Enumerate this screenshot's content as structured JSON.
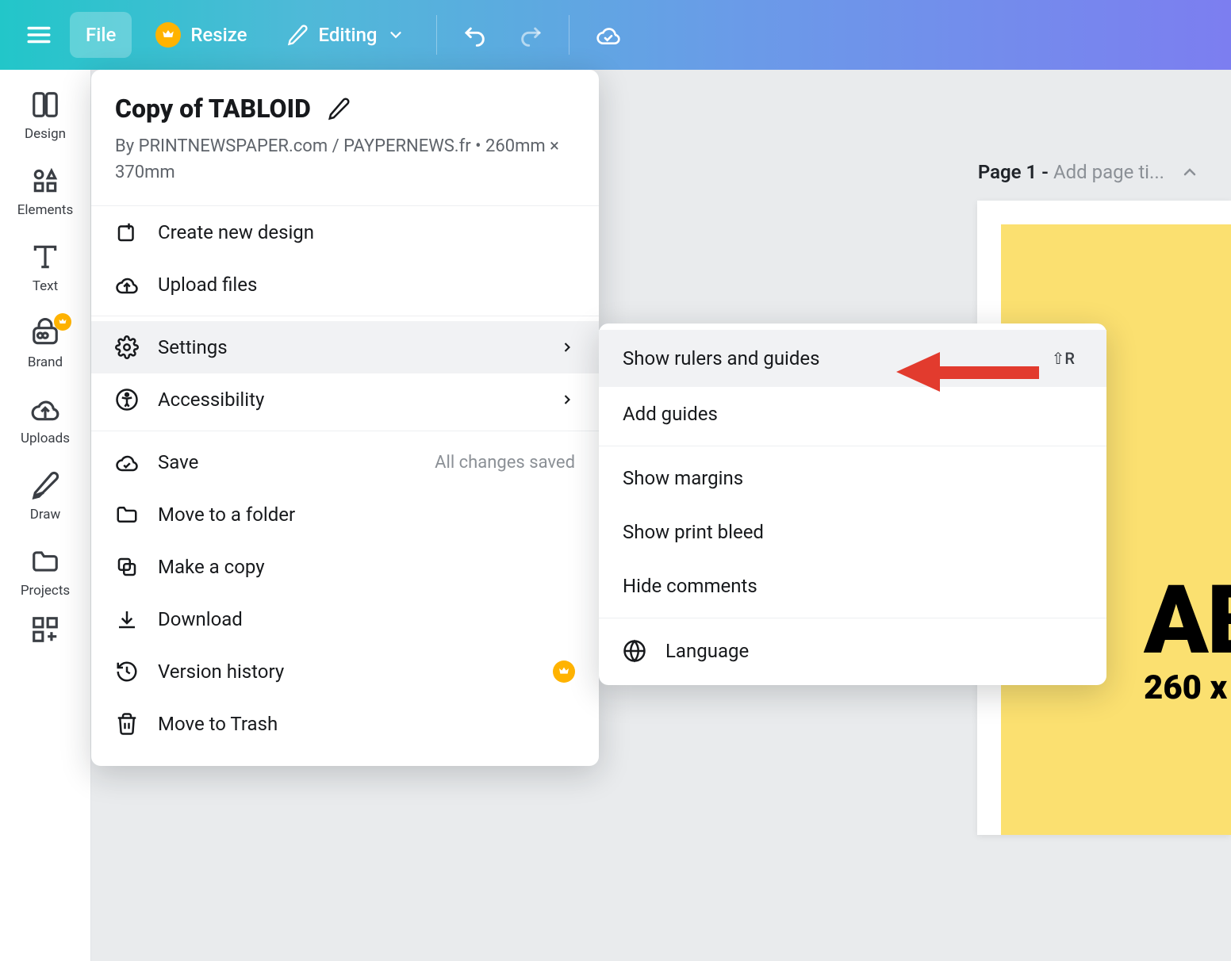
{
  "topbar": {
    "file_label": "File",
    "resize_label": "Resize",
    "editing_label": "Editing"
  },
  "sidebar": {
    "items": [
      {
        "label": "Design"
      },
      {
        "label": "Elements"
      },
      {
        "label": "Text"
      },
      {
        "label": "Brand"
      },
      {
        "label": "Uploads"
      },
      {
        "label": "Draw"
      },
      {
        "label": "Projects"
      }
    ]
  },
  "file_menu": {
    "title": "Copy of TABLOID",
    "byline": "By PRINTNEWSPAPER.com / PAYPERNEWS.fr • 260mm × 370mm",
    "items": {
      "create": "Create new design",
      "upload": "Upload files",
      "settings": "Settings",
      "accessibility": "Accessibility",
      "save": "Save",
      "save_hint": "All changes saved",
      "move_folder": "Move to a folder",
      "make_copy": "Make a copy",
      "download": "Download",
      "version_history": "Version history",
      "trash": "Move to Trash"
    }
  },
  "settings_menu": {
    "show_rulers": "Show rulers and guides",
    "show_rulers_shortcut": "⇧R",
    "add_guides": "Add guides",
    "show_margins": "Show margins",
    "show_print_bleed": "Show print bleed",
    "hide_comments": "Hide comments",
    "language": "Language"
  },
  "page": {
    "label": "Page 1 - ",
    "placeholder": "Add page ti..."
  },
  "document": {
    "heading": "AB",
    "sub": "260 x"
  }
}
